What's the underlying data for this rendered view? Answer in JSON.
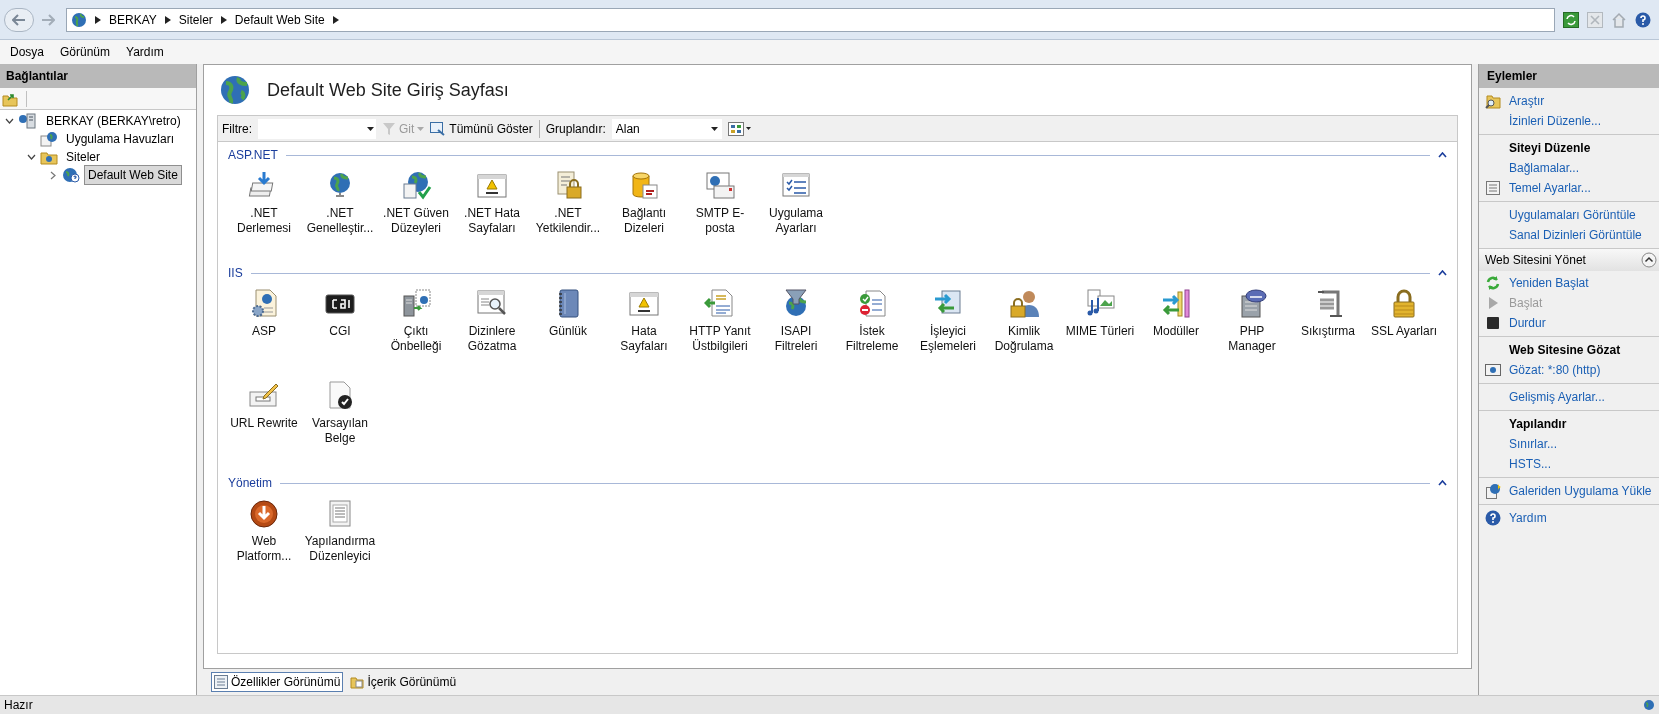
{
  "breadcrumb": [
    "BERKAY",
    "Siteler",
    "Default Web Site"
  ],
  "menu": [
    "Dosya",
    "Görünüm",
    "Yardım"
  ],
  "connections": {
    "title": "Bağlantılar",
    "tree": [
      {
        "label": "BERKAY (BERKAY\\retro)",
        "expanded": true,
        "selected": false,
        "children": [
          {
            "label": "Uygulama Havuzları",
            "selected": false
          },
          {
            "label": "Siteler",
            "expanded": true,
            "selected": false,
            "children": [
              {
                "label": "Default Web Site",
                "expanded": false,
                "selected": true
              }
            ]
          }
        ]
      }
    ]
  },
  "page_title": "Default Web Site Giriş Sayfası",
  "toolbar": {
    "filter_label": "Filtre:",
    "go": {
      "label": "Git",
      "disabled": true
    },
    "show_all": "Tümünü Göster",
    "group_label": "Gruplandır:",
    "group_value": "Alan"
  },
  "groups": [
    {
      "title": "ASP.NET",
      "features": [
        ".NET Derlemesi",
        ".NET Genelleştir...",
        ".NET Güven Düzeyleri",
        ".NET Hata Sayfaları",
        ".NET Yetkilendir...",
        "Bağlantı Dizeleri",
        "SMTP E-posta",
        "Uygulama Ayarları"
      ]
    },
    {
      "title": "IIS",
      "features": [
        "ASP",
        "CGI",
        "Çıktı Önbelleği",
        "Dizinlere Gözatma",
        "Günlük",
        "Hata Sayfaları",
        "HTTP Yanıt Üstbilgileri",
        "ISAPI Filtreleri",
        "İstek Filtreleme",
        "İşleyici Eşlemeleri",
        "Kimlik Doğrulama",
        "MIME Türleri",
        "Modüller",
        "PHP Manager",
        "Sıkıştırma",
        "SSL Ayarları",
        "URL Rewrite",
        "Varsayılan Belge"
      ]
    },
    {
      "title": "Yönetim",
      "features": [
        "Web Platform...",
        "Yapılandırma Düzenleyici"
      ]
    }
  ],
  "view_tabs": [
    {
      "label": "Özellikler Görünümü",
      "selected": true
    },
    {
      "label": "İçerik Görünümü",
      "selected": false
    }
  ],
  "actions": {
    "title": "Eylemler",
    "sections": [
      {
        "kind": "plain",
        "items": [
          {
            "kind": "link",
            "label": "Araştır",
            "disabled": false
          },
          {
            "kind": "link",
            "label": "İzinleri Düzenle...",
            "disabled": false
          }
        ]
      },
      {
        "kind": "plain",
        "items": [
          {
            "kind": "heading",
            "label": "Siteyi Düzenle"
          },
          {
            "kind": "link",
            "label": "Bağlamalar...",
            "disabled": false
          },
          {
            "kind": "link",
            "label": "Temel Ayarlar...",
            "disabled": false
          }
        ]
      },
      {
        "kind": "plain",
        "items": [
          {
            "kind": "link",
            "label": "Uygulamaları Görüntüle",
            "disabled": false
          },
          {
            "kind": "link",
            "label": "Sanal Dizinleri Görüntüle",
            "disabled": false
          }
        ]
      },
      {
        "kind": "collapsible",
        "title": "Web Sitesini Yönet",
        "expanded": true,
        "items": [
          {
            "kind": "link",
            "label": "Yeniden Başlat",
            "disabled": false
          },
          {
            "kind": "link",
            "label": "Başlat",
            "disabled": true
          },
          {
            "kind": "link",
            "label": "Durdur",
            "disabled": false
          }
        ]
      },
      {
        "kind": "plain",
        "items": [
          {
            "kind": "heading",
            "label": "Web Sitesine Gözat"
          },
          {
            "kind": "link",
            "label": "Gözat: *:80 (http)",
            "disabled": false
          }
        ]
      },
      {
        "kind": "plain",
        "items": [
          {
            "kind": "link",
            "label": "Gelişmiş Ayarlar...",
            "disabled": false
          }
        ]
      },
      {
        "kind": "plain",
        "items": [
          {
            "kind": "heading",
            "label": "Yapılandır"
          },
          {
            "kind": "link",
            "label": "Sınırlar...",
            "disabled": false
          },
          {
            "kind": "link",
            "label": "HSTS...",
            "disabled": false
          }
        ]
      },
      {
        "kind": "plain",
        "items": [
          {
            "kind": "link",
            "label": "Galeriden Uygulama Yükle",
            "disabled": false
          }
        ]
      },
      {
        "kind": "plain",
        "items": [
          {
            "kind": "link",
            "label": "Yardım",
            "disabled": false
          }
        ]
      }
    ]
  },
  "status_bar": "Hazır"
}
